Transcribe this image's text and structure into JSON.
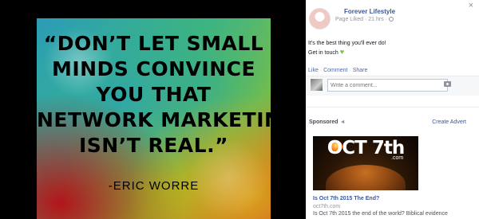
{
  "photo": {
    "quote_lines": [
      "“DON’T LET SMALL",
      "MINDS CONVINCE",
      "YOU THAT",
      "NETWORK MARKETING",
      "ISN’T REAL.”"
    ],
    "author": "-ERIC WORRE"
  },
  "panel": {
    "close_icon": "×",
    "page_name": "Forever Lifestyle",
    "meta": "Page Liked · 21 hrs ·",
    "post_lines": [
      "It's the best thing you'll ever do!",
      "Get in touch"
    ],
    "heart_icon": "♥",
    "actions": {
      "like": "Like",
      "comment": "Comment",
      "share": "Share",
      "sep": "·"
    },
    "comment_placeholder": "Write a comment...",
    "sponsored": "Sponsored",
    "sponsored_icon": "◄",
    "create_advert": "Create Advert",
    "ad": {
      "headline": "OCT 7th",
      "headline_suffix": ".com",
      "title": "Is Oct 7th 2015 The End?",
      "domain": "oct7th.com",
      "description": "Is Oct 7th 2015 the end of the world? Biblical evidence"
    }
  }
}
